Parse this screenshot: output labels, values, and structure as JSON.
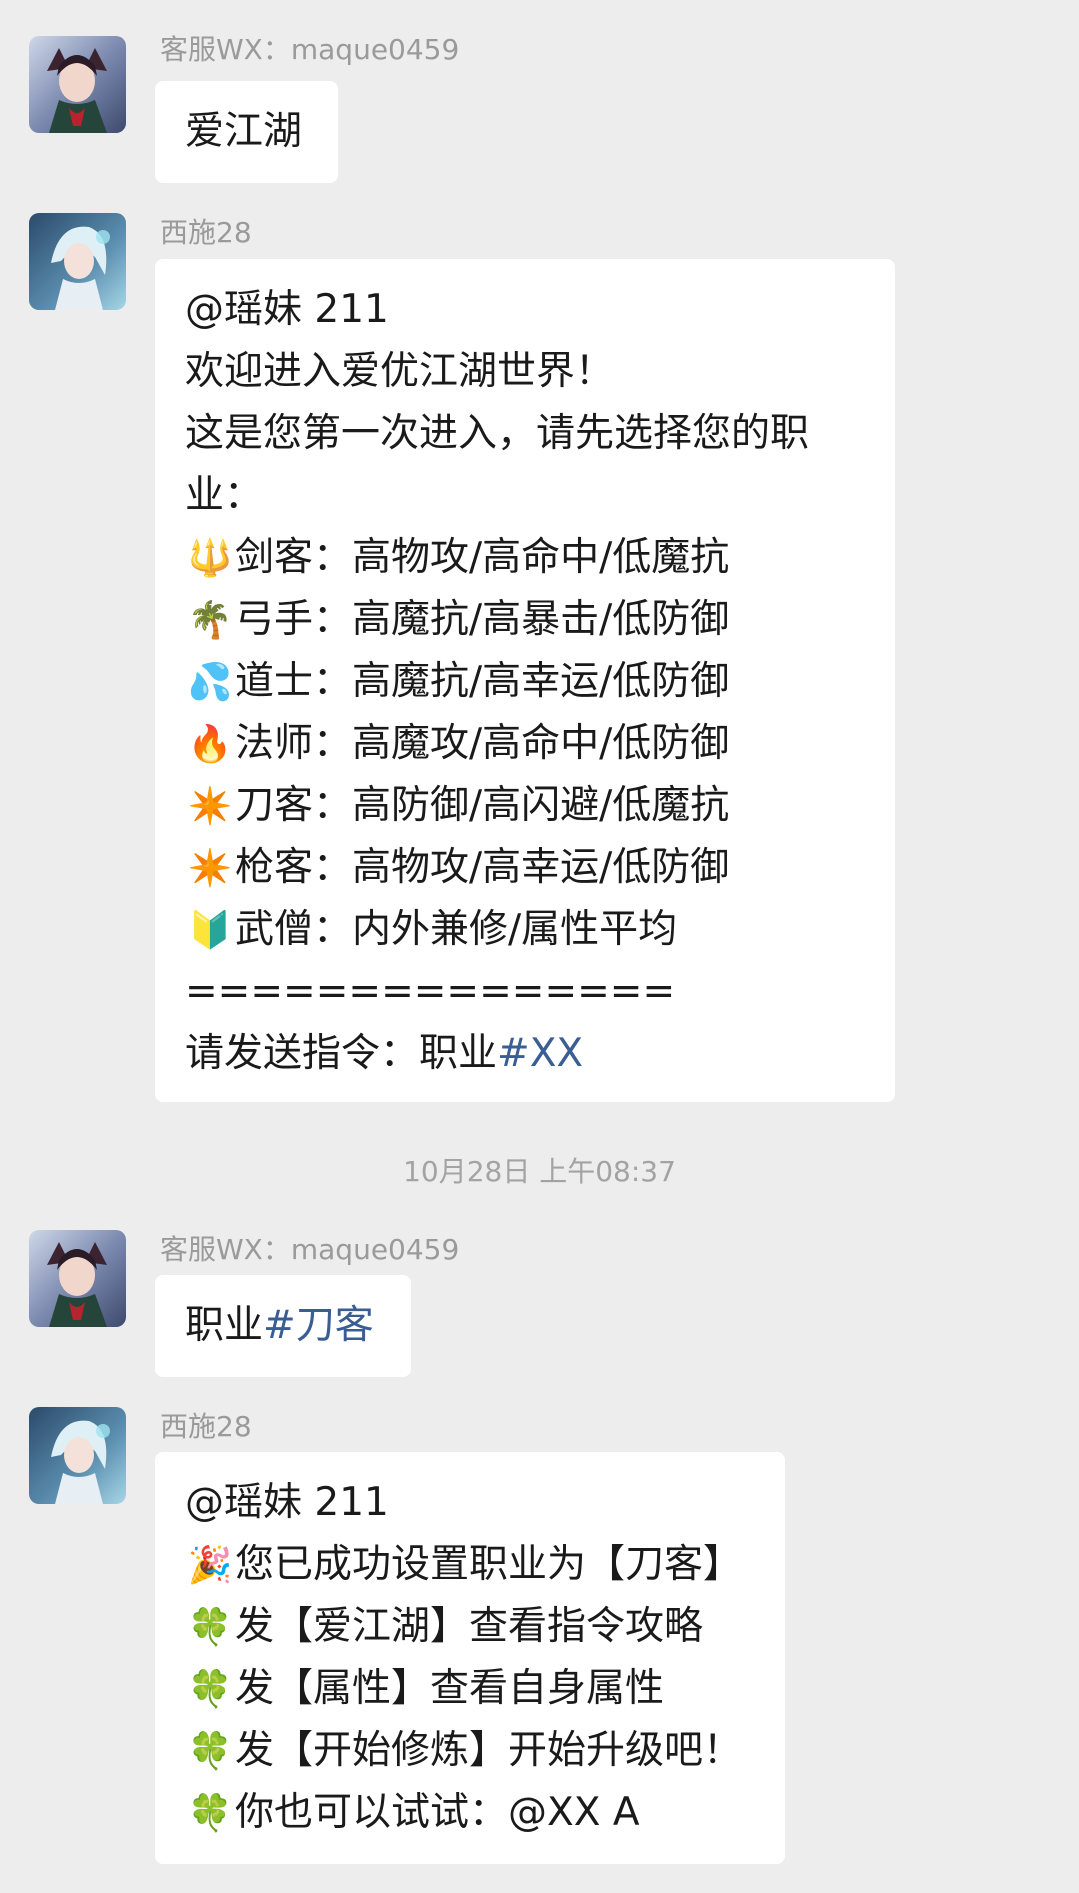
{
  "messages": [
    {
      "sender": "客服WX：maque0459",
      "lines": [
        {
          "text": "爱江湖"
        }
      ]
    },
    {
      "sender": "西施28",
      "lines": [
        {
          "text": "@瑶妹 211"
        },
        {
          "text": "欢迎进入爱优江湖世界！"
        },
        {
          "text": "这是您第一次进入，请先选择您的职"
        },
        {
          "text": "业："
        },
        {
          "emoji": "🔱",
          "emoji_name": "trident-icon",
          "text": "剑客：高物攻/高命中/低魔抗"
        },
        {
          "emoji": "🌴",
          "emoji_name": "palm-tree-icon",
          "text": "弓手：高魔抗/高暴击/低防御"
        },
        {
          "emoji": "💦",
          "emoji_name": "sweat-droplets-icon",
          "text": "道士：高魔抗/高幸运/低防御"
        },
        {
          "emoji": "🔥",
          "emoji_name": "fire-icon",
          "text": "法师：高魔攻/高命中/低防御"
        },
        {
          "emoji": "✴️",
          "emoji_name": "eight-pointed-star-icon",
          "text": "刀客：高防御/高闪避/低魔抗"
        },
        {
          "emoji": "✴️",
          "emoji_name": "eight-pointed-star-icon",
          "text": "枪客：高物攻/高幸运/低防御"
        },
        {
          "emoji": "🔰",
          "emoji_name": "beginner-symbol-icon",
          "text": "武僧：内外兼修/属性平均"
        },
        {
          "text": "==============="
        },
        {
          "text": "请发送指令：职业",
          "tag": "#XX"
        }
      ]
    },
    {
      "sender": "客服WX：maque0459",
      "lines": [
        {
          "text": "职业",
          "tag": "#刀客"
        }
      ]
    },
    {
      "sender": "西施28",
      "lines": [
        {
          "text": "@瑶妹 211"
        },
        {
          "emoji": "🎉",
          "emoji_name": "party-popper-icon",
          "text": "您已成功设置职业为【刀客】"
        },
        {
          "emoji": "🍀",
          "emoji_name": "four-leaf-clover-icon",
          "text": "发【爱江湖】查看指令攻略"
        },
        {
          "emoji": "🍀",
          "emoji_name": "four-leaf-clover-icon",
          "text": "发【属性】查看自身属性"
        },
        {
          "emoji": "🍀",
          "emoji_name": "four-leaf-clover-icon",
          "text": "发【开始修炼】开始升级吧！"
        },
        {
          "emoji": "🍀",
          "emoji_name": "four-leaf-clover-icon",
          "text": "你也可以试试：@XX A"
        }
      ]
    }
  ],
  "timestamp": "10月28日 上午08:37",
  "colors": {
    "background": "#ededed",
    "bubble": "#ffffff",
    "tag": "#3a5d93",
    "meta_text": "#9a9a9a"
  }
}
